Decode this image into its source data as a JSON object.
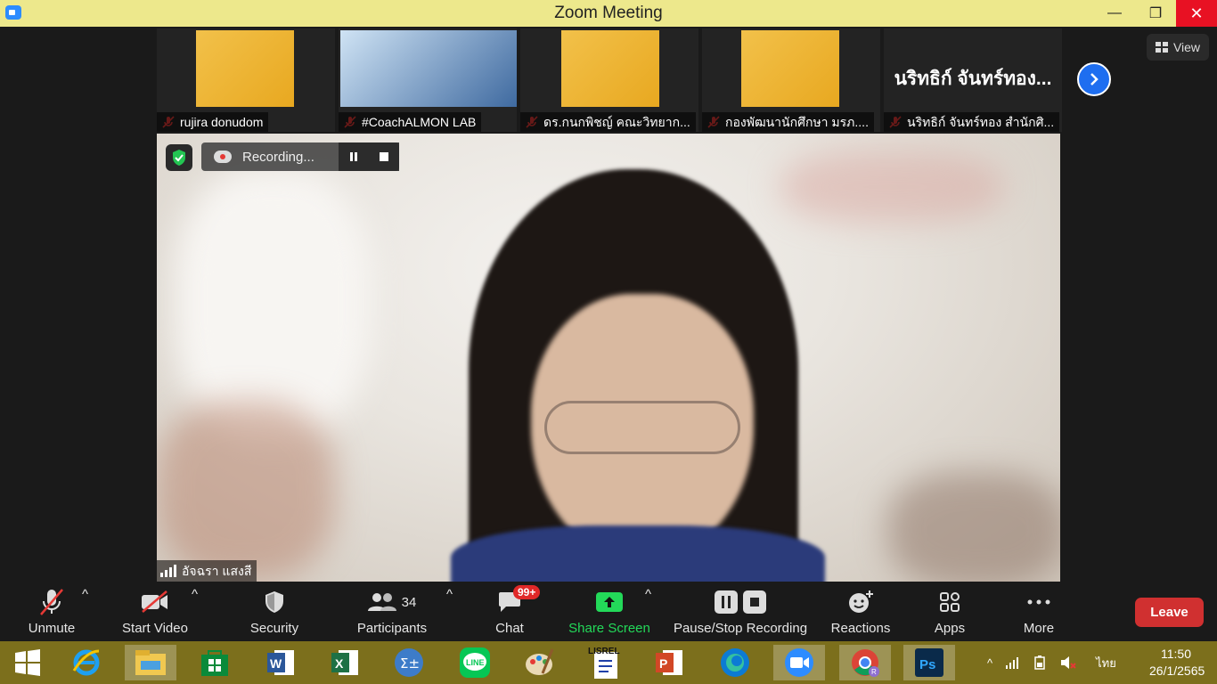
{
  "window": {
    "title": "Zoom Meeting",
    "minimize": "—",
    "maximize": "❐",
    "close": "✕"
  },
  "view_button": {
    "label": "View"
  },
  "gallery": [
    {
      "name": "rujira donudom"
    },
    {
      "name": "#CoachALMON LAB"
    },
    {
      "name": "ดร.กนกพิชญ์ คณะวิทยาก..."
    },
    {
      "name": "กองพัฒนานักศึกษา มรภ...."
    },
    {
      "name": "นริทธิก์ จันทร์ทอง สำนักศิ...",
      "display_name": "นริทธิก์ จันทร์ทอง..."
    }
  ],
  "main_speaker": {
    "name": "อัจฉรา แสงสี"
  },
  "recording": {
    "status": "Recording...",
    "pause_icon": "pause-icon",
    "stop_icon": "stop-icon"
  },
  "toolbar": {
    "unmute": "Unmute",
    "start_video": "Start Video",
    "security": "Security",
    "participants": "Participants",
    "participants_count": "34",
    "chat": "Chat",
    "chat_badge": "99+",
    "share_screen": "Share Screen",
    "pause_stop_recording": "Pause/Stop Recording",
    "reactions": "Reactions",
    "apps": "Apps",
    "more": "More",
    "leave": "Leave"
  },
  "colors": {
    "title_bar": "#ede88c",
    "share_green": "#23d959",
    "leave_red": "#d03030",
    "taskbar": "#7c6f1c",
    "accent_blue": "#1e6ef0"
  },
  "taskbar": {
    "apps": [
      "start-icon",
      "internet-explorer-icon",
      "file-explorer-icon",
      "store-icon",
      "word-icon",
      "excel-icon",
      "math-input-icon",
      "line-icon",
      "paint-icon",
      "lisrel-icon",
      "powerpoint-icon",
      "edge-icon",
      "zoom-icon",
      "chrome-icon",
      "photoshop-icon"
    ],
    "lisrel_label": "LISREL",
    "language": "ไทย",
    "time": "11:50",
    "date": "26/1/2565"
  }
}
